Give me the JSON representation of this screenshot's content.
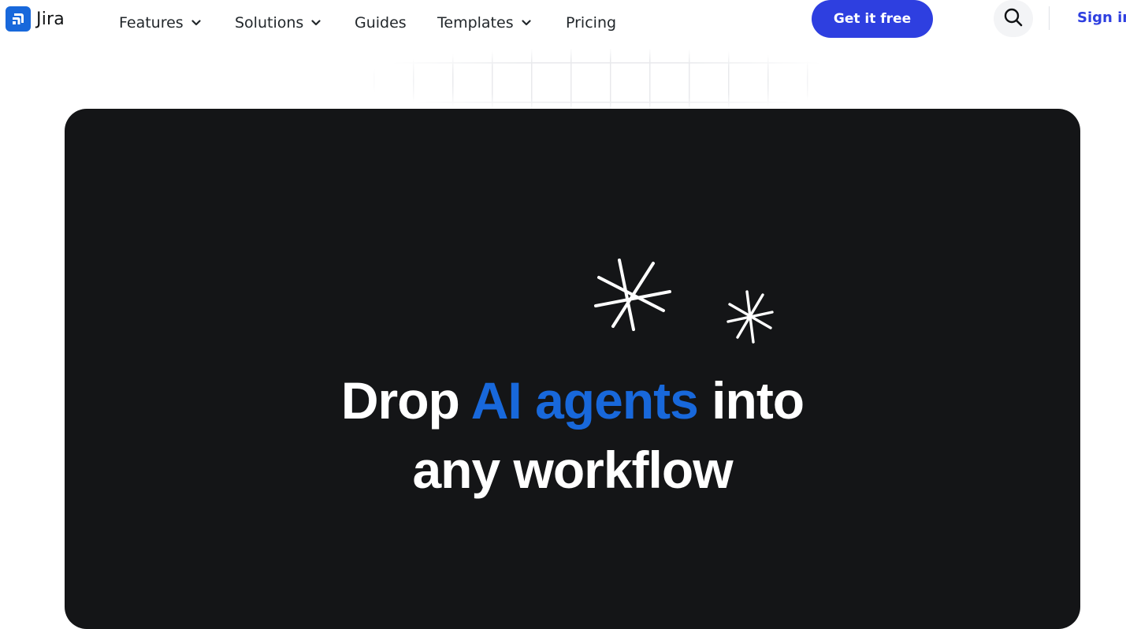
{
  "brand": {
    "name": "Jira",
    "color": "#1868db"
  },
  "nav": {
    "items": [
      {
        "label": "Features",
        "has_dropdown": true
      },
      {
        "label": "Solutions",
        "has_dropdown": true
      },
      {
        "label": "Guides",
        "has_dropdown": false
      },
      {
        "label": "Templates",
        "has_dropdown": true
      },
      {
        "label": "Pricing",
        "has_dropdown": false
      }
    ],
    "cta_label": "Get it free",
    "search_icon": "search-icon",
    "signin_label": "Sign in"
  },
  "hero": {
    "title_start": "Drop ",
    "title_accent": "AI agents",
    "title_middle": " into",
    "title_end": "any workflow",
    "background_color": "#141517",
    "accent_color": "#1868db",
    "decorations": [
      "sparkle-icon",
      "sparkle-icon"
    ]
  },
  "colors": {
    "cta": "#2e3fe0",
    "text": "#22272b"
  }
}
